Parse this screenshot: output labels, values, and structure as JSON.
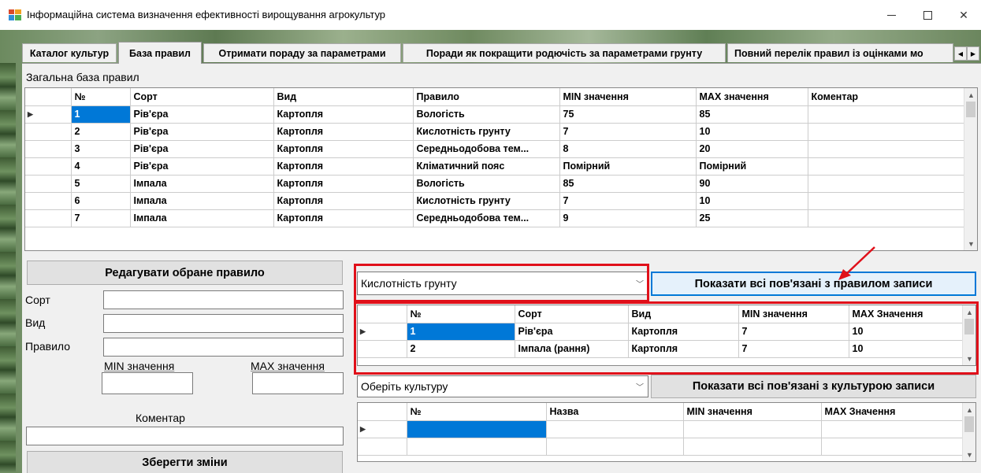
{
  "window": {
    "title": "Інформаційна система визначення ефективності вирощування агрокультур"
  },
  "tabs": [
    {
      "label": "Каталог культур"
    },
    {
      "label": "База правил"
    },
    {
      "label": "Отримати пораду за параметрами"
    },
    {
      "label": "Поради як покращити родючість за параметрами грунту"
    },
    {
      "label": "Повний перелік правил із оцінками мо"
    }
  ],
  "general_rules": {
    "label": "Загальна база правил",
    "columns": [
      "№",
      "Сорт",
      "Вид",
      "Правило",
      "MIN значення",
      "MAX значення",
      "Коментар"
    ],
    "rows": [
      [
        "1",
        "Рів'єра",
        "Картопля",
        "Вологість",
        "75",
        "85",
        ""
      ],
      [
        "2",
        "Рів'єра",
        "Картопля",
        "Кислотність грунту",
        "7",
        "10",
        ""
      ],
      [
        "3",
        "Рів'єра",
        "Картопля",
        "Середньодобова тем...",
        "8",
        "20",
        ""
      ],
      [
        "4",
        "Рів'єра",
        "Картопля",
        "Кліматичний пояс",
        "Помірний",
        "Помірний",
        ""
      ],
      [
        "5",
        "Імпала",
        "Картопля",
        "Вологість",
        "85",
        "90",
        ""
      ],
      [
        "6",
        "Імпала",
        "Картопля",
        "Кислотність грунту",
        "7",
        "10",
        ""
      ],
      [
        "7",
        "Імпала",
        "Картопля",
        "Середньодобова тем...",
        "9",
        "25",
        ""
      ]
    ]
  },
  "edit_form": {
    "header_button": "Редагувати обране правило",
    "sort_label": "Сорт",
    "type_label": "Вид",
    "rule_label": "Правило",
    "min_label": "MIN значення",
    "max_label": "MAX значення",
    "comment_label": "Коментар",
    "save_button": "Зберегти зміни"
  },
  "rule_filter": {
    "selected": "Кислотність грунту",
    "show_button": "Показати всі пов'язані з правилом записи",
    "columns": [
      "№",
      "Сорт",
      "Вид",
      "MIN значення",
      "MAX Значення"
    ],
    "rows": [
      [
        "1",
        "Рів'єра",
        "Картопля",
        "7",
        "10"
      ],
      [
        "2",
        "Імпала (рання)",
        "Картопля",
        "7",
        "10"
      ]
    ]
  },
  "culture_filter": {
    "selected": "Оберіть культуру",
    "show_button": "Показати всі пов'язані з культурою записи",
    "columns": [
      "№",
      "Назва",
      "MIN значення",
      "MAX Значення"
    ],
    "rows": [
      [
        "",
        "",
        "",
        ""
      ],
      [
        "",
        "",
        "",
        ""
      ]
    ]
  },
  "icons": {
    "row_pointer": "row-pointer-icon",
    "dropdown": "chevron-down-icon",
    "scroll_up": "scroll-up-icon",
    "scroll_down": "scroll-down-icon"
  },
  "colors": {
    "selection": "#0078d7",
    "highlight": "#e0101a"
  }
}
